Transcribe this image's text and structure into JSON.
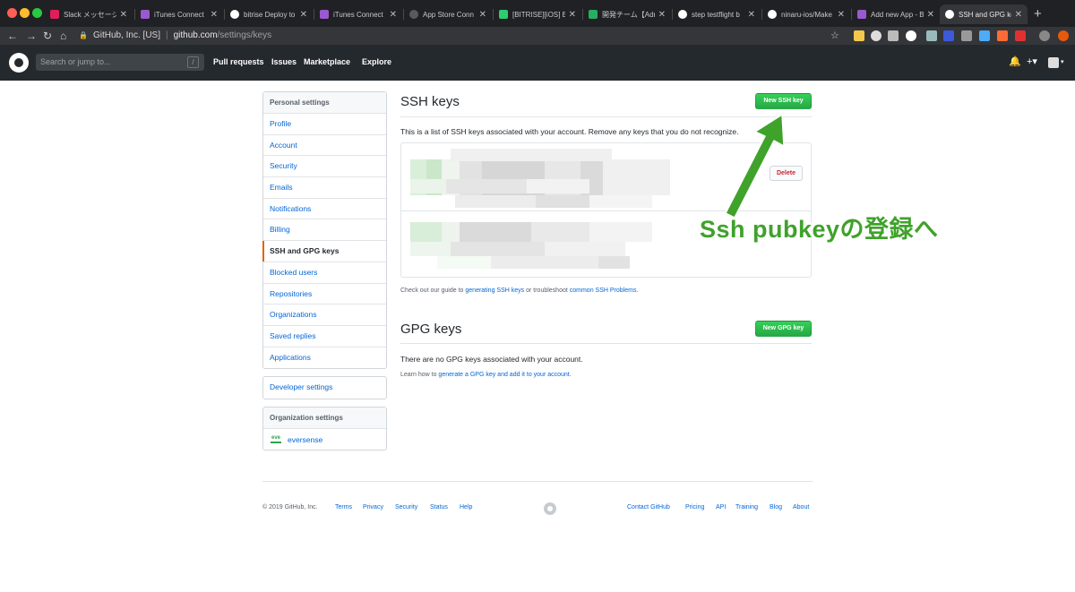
{
  "browser": {
    "tabs": [
      {
        "title": "Slack メッセージ",
        "favicon_color": "#e01e5a"
      },
      {
        "title": "iTunes Connect",
        "favicon_color": "#9b59d0"
      },
      {
        "title": "bitrise Deploy to",
        "favicon_color": "#ffffff"
      },
      {
        "title": "iTunes Connect",
        "favicon_color": "#9b59d0"
      },
      {
        "title": "App Store Conn",
        "favicon_color": "#3c3c3c"
      },
      {
        "title": "[BITRISE][iOS] B",
        "favicon_color": "#2ecc71"
      },
      {
        "title": "開発チーム【Adm",
        "favicon_color": "#27ae60"
      },
      {
        "title": "step testflight b",
        "favicon_color": "#ffffff"
      },
      {
        "title": "ninaru-ios/Make",
        "favicon_color": "#ffffff"
      },
      {
        "title": "Add new App - B",
        "favicon_color": "#9b59d0"
      },
      {
        "title": "SSH and GPG ke",
        "favicon_color": "#ffffff"
      }
    ],
    "address": {
      "site_identity": "GitHub, Inc. [US]",
      "url_host": "github.com",
      "url_path": "/settings/keys"
    }
  },
  "github_header": {
    "search_placeholder": "Search or jump to...",
    "search_shortcut": "/",
    "nav": [
      "Pull requests",
      "Issues",
      "Marketplace",
      "Explore"
    ]
  },
  "sidebar": {
    "personal_heading": "Personal settings",
    "items": [
      "Profile",
      "Account",
      "Security",
      "Emails",
      "Notifications",
      "Billing",
      "SSH and GPG keys",
      "Blocked users",
      "Repositories",
      "Organizations",
      "Saved replies",
      "Applications"
    ],
    "selected_index": 6,
    "developer_settings": "Developer settings",
    "org_heading": "Organization settings",
    "org_logo_text": "eve",
    "org_name": "eversense"
  },
  "ssh": {
    "title": "SSH keys",
    "new_button": "New SSH key",
    "description": "This is a list of SSH keys associated with your account. Remove any keys that you do not recognize.",
    "delete_button": "Delete",
    "guide_prefix": "Check out our guide to ",
    "guide_link1": "generating SSH keys",
    "guide_middle": " or troubleshoot ",
    "guide_link2": "common SSH Problems",
    "guide_suffix": "."
  },
  "gpg": {
    "title": "GPG keys",
    "new_button": "New GPG key",
    "empty_text": "There are no GPG keys associated with your account.",
    "learn_prefix": "Learn how to ",
    "learn_link": "generate a GPG key and add it to your account",
    "learn_suffix": "."
  },
  "footer": {
    "copyright": "© 2019 GitHub, Inc.",
    "left_links": [
      "Terms",
      "Privacy",
      "Security",
      "Status",
      "Help"
    ],
    "right_links": [
      "Contact GitHub",
      "Pricing",
      "API",
      "Training",
      "Blog",
      "About"
    ]
  },
  "annotation": {
    "text": "Ssh pubkeyの登録へ",
    "color": "#3fa22b"
  },
  "colors": {
    "link": "#0366d6",
    "header_bg": "#24292e",
    "button_green": "#28a745",
    "danger": "#cb2431",
    "selected_marker": "#e36209"
  }
}
